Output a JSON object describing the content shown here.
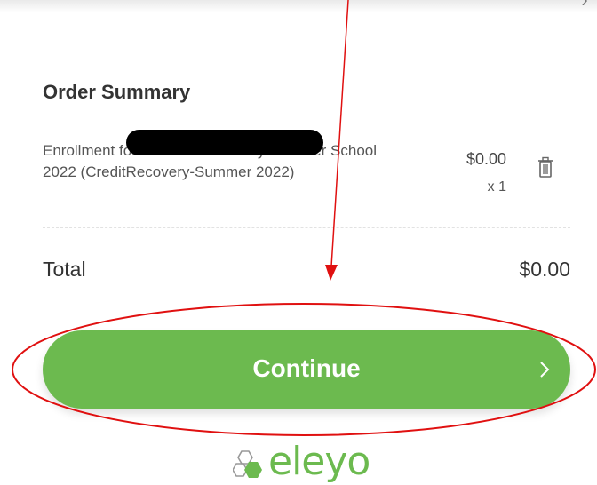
{
  "order": {
    "title": "Order Summary",
    "item": {
      "description": "Enrollment for                            in Credit Recovery Summer School 2022 (CreditRecovery-Summer 2022)",
      "price": "$0.00",
      "quantity": "x 1"
    },
    "total_label": "Total",
    "total_value": "$0.00"
  },
  "actions": {
    "continue_label": "Continue"
  },
  "brand": {
    "logo_text": "eleyo",
    "color": "#6cba4f"
  },
  "icons": {
    "delete": "trash-icon",
    "continue": "chevron-right-icon"
  }
}
